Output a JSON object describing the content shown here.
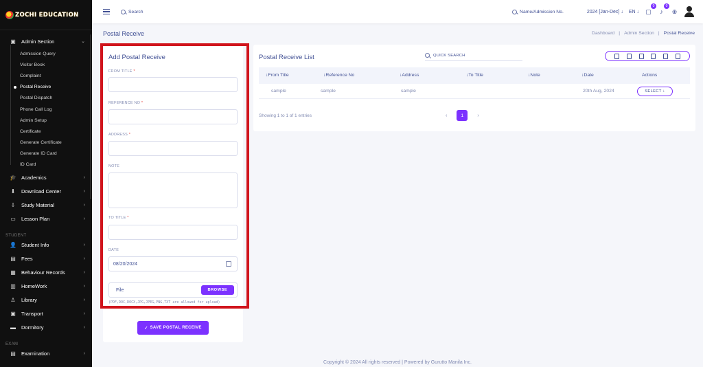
{
  "sidebar": {
    "logo_text": "ZOCHI EDUCATION",
    "admin_section": {
      "label": "Admin Section",
      "items": [
        "Admission Query",
        "Visitor Book",
        "Complaint",
        "Postal Receive",
        "Postal Dispatch",
        "Phone Call Log",
        "Admin Setup",
        "Certificate",
        "Generate Certificate",
        "Generate ID Card",
        "ID Card"
      ]
    },
    "menus_top": [
      "Academics",
      "Download Center",
      "Study Material",
      "Lesson Plan"
    ],
    "section_student": "STUDENT",
    "menus_student": [
      "Student Info",
      "Fees",
      "Behaviour Records",
      "HomeWork",
      "Library",
      "Transport",
      "Dormitory"
    ],
    "section_exam": "EXAM",
    "menus_exam": [
      "Examination"
    ]
  },
  "topbar": {
    "search_label": "Search",
    "name_search": "Name/Admission No.",
    "year": "2024 [Jan-Dec]",
    "lang": "EN",
    "chat_badge": "0",
    "bell_badge": "0"
  },
  "page": {
    "title": "Postal Receive",
    "breadcrumb": [
      "Dashboard",
      "Admin Section",
      "Postal Receive"
    ],
    "sep": "|"
  },
  "form": {
    "title": "Add Postal Receive",
    "from_title_label": "FROM TITLE",
    "reference_label": "REFERENCE NO",
    "address_label": "ADDRESS",
    "note_label": "NOTE",
    "to_title_label": "TO TITLE",
    "date_label": "DATE",
    "required_mark": "*",
    "date_value": "08/20/2024",
    "file_placeholder": "File",
    "browse_label": "BROWSE",
    "file_note": "(PDF,DOC,DOCX,JPG,JPEG,PNG,TXT are allowed for upload)",
    "save_label": "SAVE POSTAL RECEIVE"
  },
  "list": {
    "title": "Postal Receive List",
    "quick_search": "QUICK SEARCH",
    "columns": [
      "From Title",
      "Reference No",
      "Address",
      "To Title",
      "Note",
      "Date",
      "Actions"
    ],
    "rows": [
      {
        "from_title": "sample",
        "reference_no": "sample",
        "address": "sample",
        "to_title": "",
        "note": "",
        "date": "20th Aug, 2024",
        "action": "SELECT"
      }
    ],
    "showing": "Showing 1 to 1 of 1 entries",
    "page": "1"
  },
  "footer": "Copyright © 2024 All rights reserved | Powered by Gurutto Manila Inc."
}
